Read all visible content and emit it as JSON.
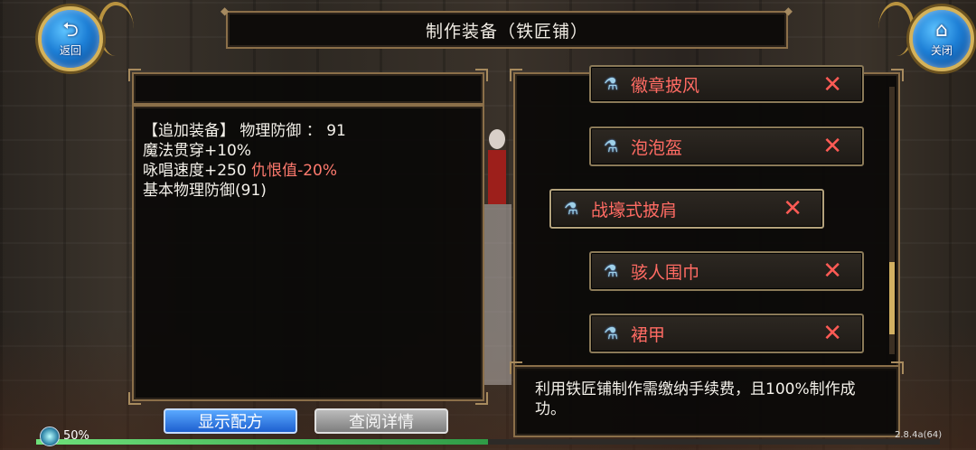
{
  "title": "制作装备（铁匠铺）",
  "nav": {
    "back_label": "返回",
    "close_label": "关闭"
  },
  "stats": {
    "line1": "【追加装备】 物理防御 ： 91",
    "line2": "魔法贯穿+10%",
    "line3_a": "咏唱速度+250 ",
    "line3_b": "仇恨值-20%",
    "line4": "基本物理防御(91)"
  },
  "items": [
    {
      "name": "徽章披风"
    },
    {
      "name": "泡泡盔"
    },
    {
      "name": "战壕式披肩"
    },
    {
      "name": "骇人围巾"
    },
    {
      "name": "裙甲"
    }
  ],
  "info": "利用铁匠铺制作需缴纳手续费，且100%制作成功。",
  "buttons": {
    "show_recipe": "显示配方",
    "view_detail": "查阅详情"
  },
  "status": {
    "percent_label": "50%",
    "percent": 0.5,
    "version": "2.8.4a(64)"
  },
  "colors": {
    "accent_red": "#ff6b63",
    "frame_gold": "#8b6f49",
    "button_blue": "#1d5fcf"
  }
}
